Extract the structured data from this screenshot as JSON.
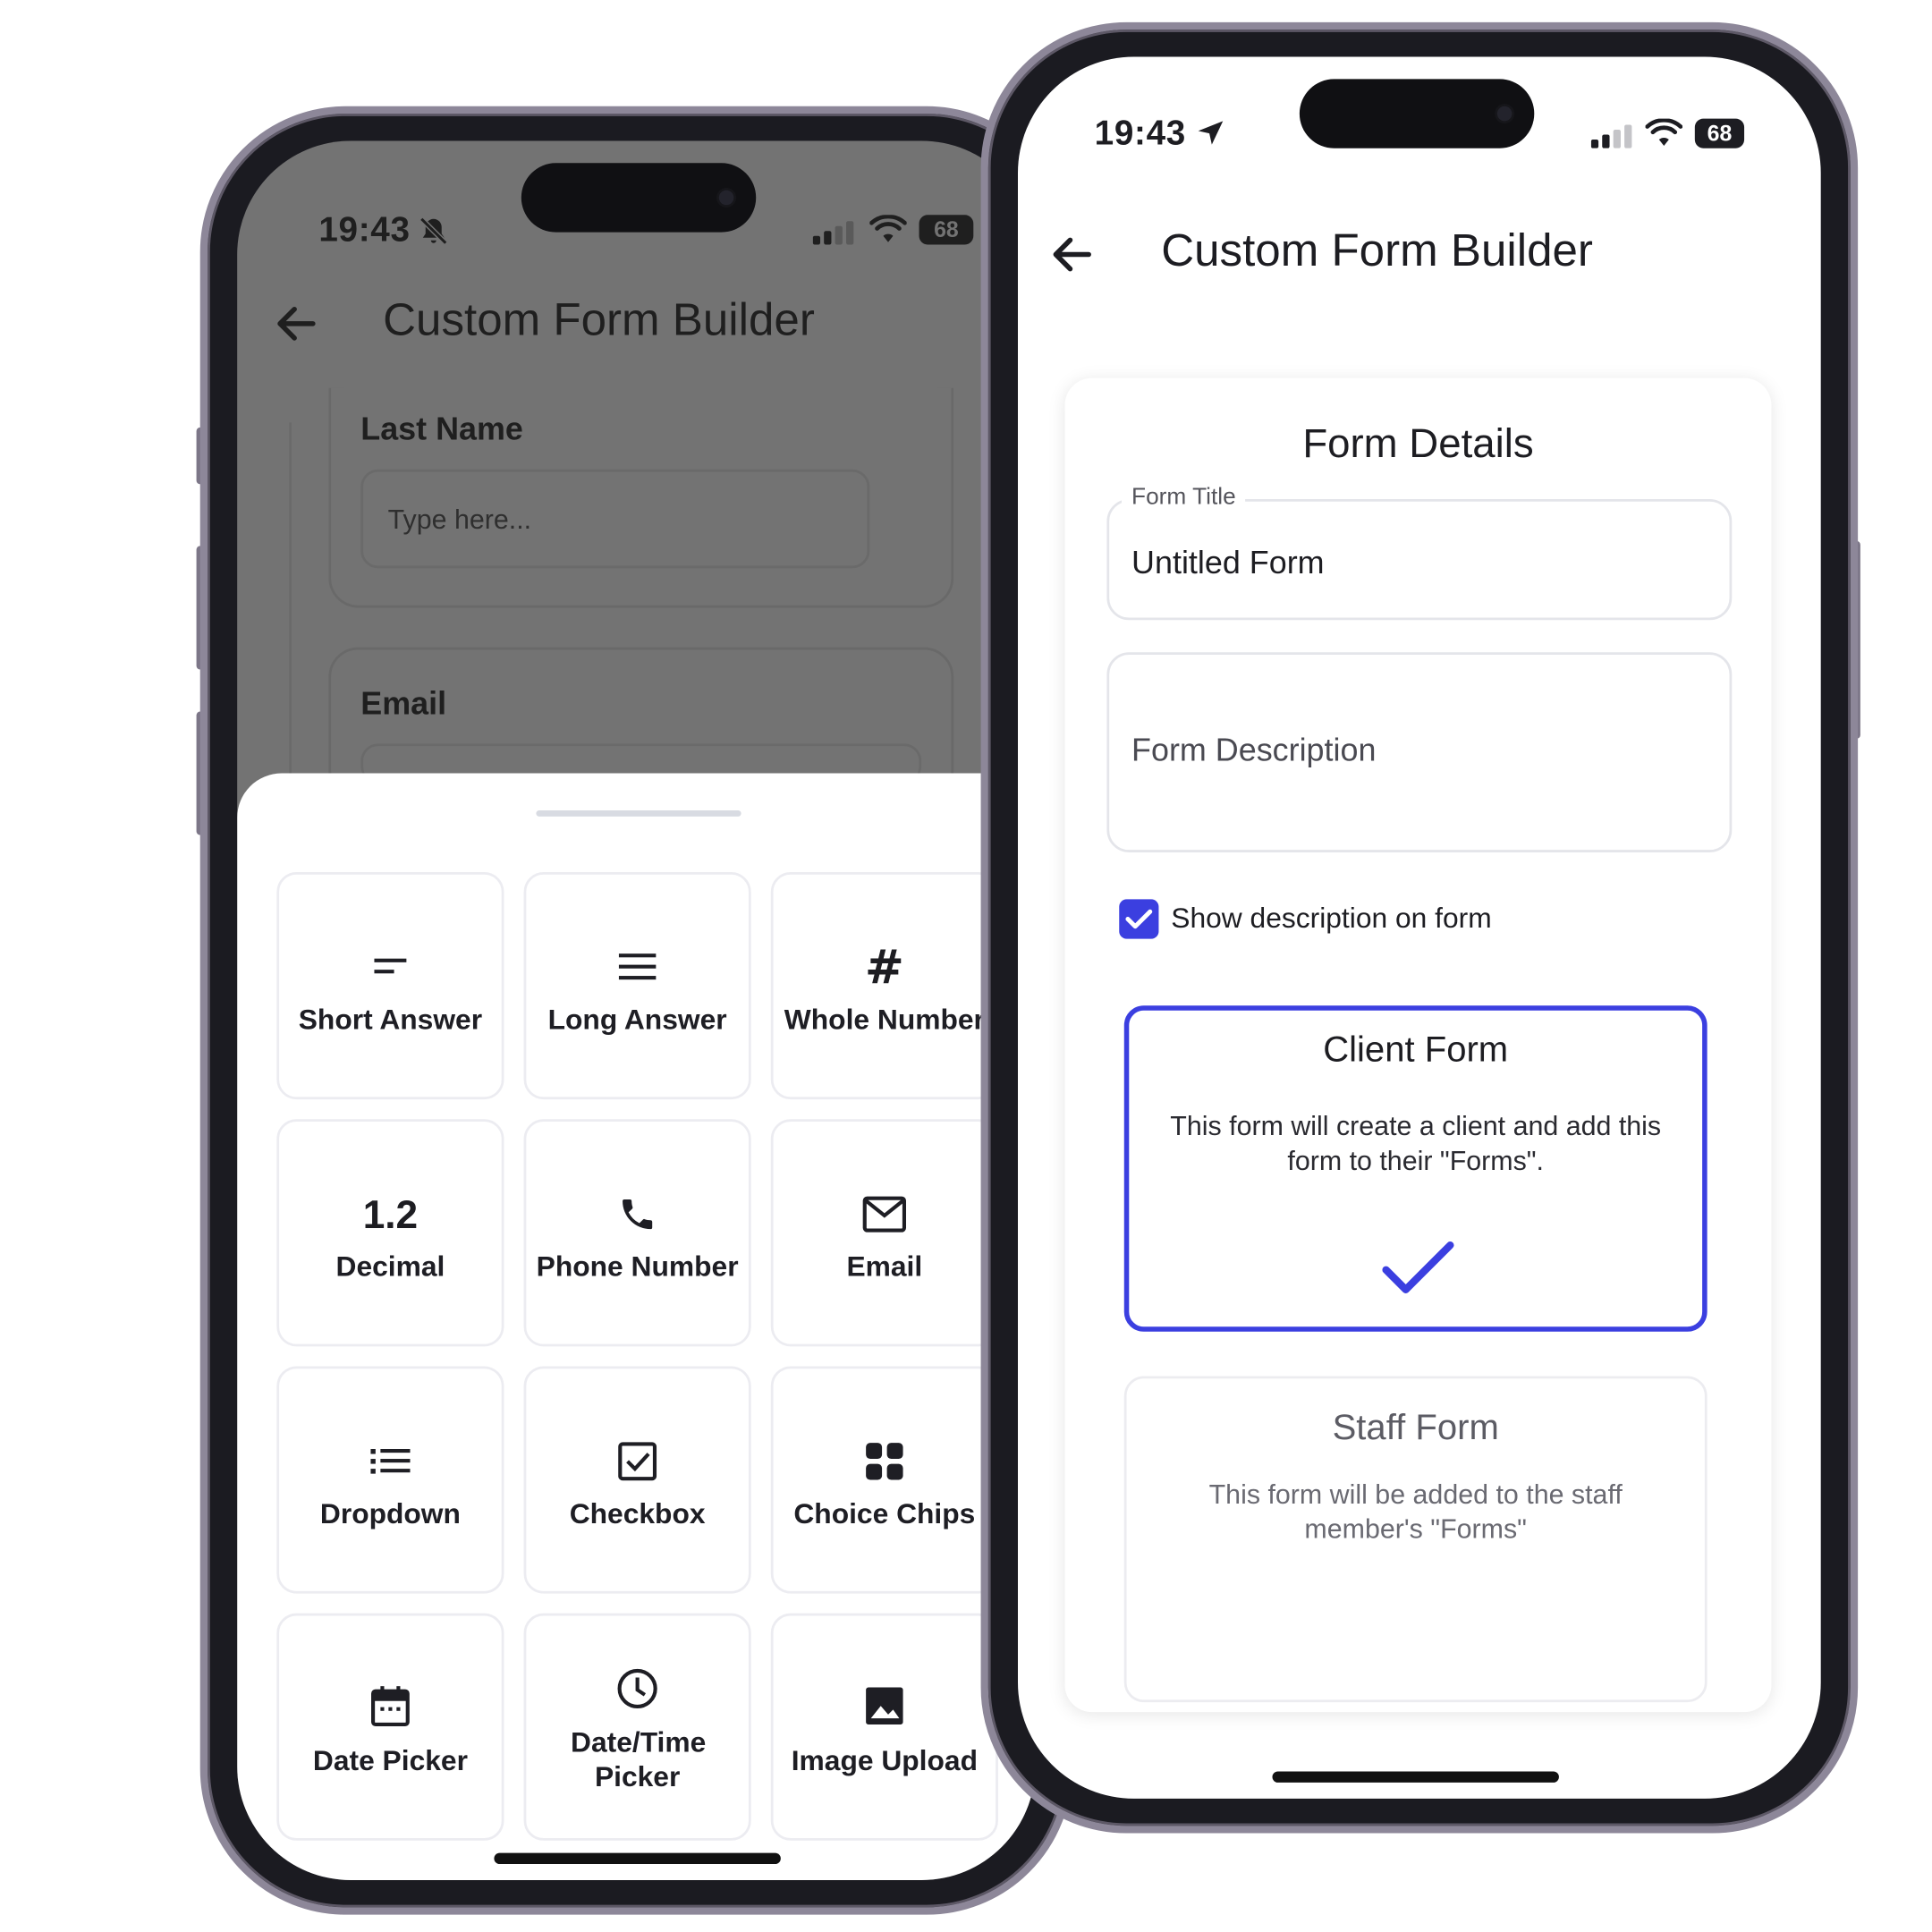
{
  "left_phone": {
    "status": {
      "time": "19:43",
      "battery": "68"
    },
    "header": {
      "title": "Custom Form Builder"
    },
    "behind": {
      "last_name_label": "Last Name",
      "input_placeholder": "Type here...",
      "email_label": "Email"
    },
    "field_types": [
      {
        "label": "Short Answer",
        "icon": "short-text-icon"
      },
      {
        "label": "Long Answer",
        "icon": "long-text-icon"
      },
      {
        "label": "Whole Number",
        "icon": "hash-icon"
      },
      {
        "label": "Decimal",
        "icon": "decimal-icon",
        "icon_text": "1.2"
      },
      {
        "label": "Phone Number",
        "icon": "phone-icon"
      },
      {
        "label": "Email",
        "icon": "mail-icon"
      },
      {
        "label": "Dropdown",
        "icon": "list-icon"
      },
      {
        "label": "Checkbox",
        "icon": "checkbox-icon"
      },
      {
        "label": "Choice Chips",
        "icon": "grid-icon"
      },
      {
        "label": "Date Picker",
        "icon": "calendar-icon"
      },
      {
        "label": "Date/Time Picker",
        "icon": "clock-icon"
      },
      {
        "label": "Image Upload",
        "icon": "image-icon"
      }
    ]
  },
  "right_phone": {
    "status": {
      "time": "19:43",
      "battery": "68"
    },
    "header": {
      "title": "Custom Form Builder"
    },
    "card": {
      "title": "Form Details",
      "form_title_label": "Form Title",
      "form_title_value": "Untitled Form",
      "description_placeholder": "Form Description",
      "show_description_label": "Show description on form",
      "show_description_checked": true,
      "options": [
        {
          "title": "Client Form",
          "description": "This form will create a client and add this form to their \"Forms\".",
          "selected": true
        },
        {
          "title": "Staff Form",
          "description": "This form will be added to the staff member's \"Forms\"",
          "selected": false
        }
      ]
    }
  },
  "colors": {
    "accent": "#3b3fe0",
    "frame": "#1b1b21",
    "overlay": "#737373"
  }
}
